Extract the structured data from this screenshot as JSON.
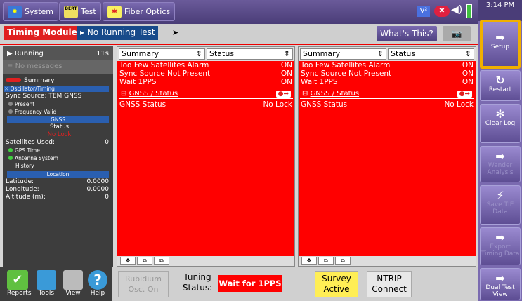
{
  "topbar": {
    "system": "System",
    "test": "Test",
    "test_icon": "BERT",
    "fiber": "Fiber Optics",
    "clock": "3:14 PM"
  },
  "tabs": {
    "module": "Timing Module",
    "test": "No Running Test",
    "whats_this": "What's This?"
  },
  "left": {
    "running": "Running",
    "time": "11s",
    "messages": "No messages",
    "summary": "Summary",
    "osc": "Oscillator/Timing",
    "sync_source": "Sync Source: TEM GNSS",
    "present": "Present",
    "freq_valid": "Frequency Valid",
    "gnss": "GNSS",
    "status_label": "Status",
    "status_value": "No Lock",
    "sat_label": "Satellites Used:",
    "sat_value": "0",
    "gps_time": "GPS Time",
    "antenna": "Antenna System",
    "history": "History",
    "location": "Location",
    "lat_label": "Latitude:",
    "lat_value": "0.0000",
    "lon_label": "Longitude:",
    "lon_value": "0.0000",
    "alt_label": "Altitude (m):",
    "alt_value": "0"
  },
  "panels": [
    {
      "select1": "Summary",
      "select2": "Status",
      "rows": [
        {
          "label": "Too Few Satellites Alarm",
          "value": "ON"
        },
        {
          "label": "Sync Source Not Present",
          "value": "ON"
        },
        {
          "label": "Wait 1PPS",
          "value": "ON"
        }
      ],
      "gnss_header": "GNSS / Status",
      "gnss_row": {
        "label": "GNSS Status",
        "value": "No Lock"
      }
    },
    {
      "select1": "Summary",
      "select2": "Status",
      "rows": [
        {
          "label": "Too Few Satellites Alarm",
          "value": "ON"
        },
        {
          "label": "Sync Source Not Present",
          "value": "ON"
        },
        {
          "label": "Wait 1PPS",
          "value": "ON"
        }
      ],
      "gnss_header": "GNSS / Status",
      "gnss_row": {
        "label": "GNSS Status",
        "value": "No Lock"
      }
    }
  ],
  "bottom": {
    "reports": "Reports",
    "tools": "Tools",
    "view": "View",
    "help": "Help",
    "rubidium": "Rubidium Osc. On",
    "tuning_label": "Tuning Status:",
    "tuning_value": "Wait for 1PPS",
    "survey": "Survey Active",
    "ntrip": "NTRIP Connect"
  },
  "sidebar": {
    "setup": "Setup",
    "restart": "Restart",
    "clear_log": "Clear Log",
    "wander": "Wander Analysis",
    "save_tie": "Save TIE Data",
    "export": "Export Timing Data",
    "dual": "Dual Test View"
  }
}
